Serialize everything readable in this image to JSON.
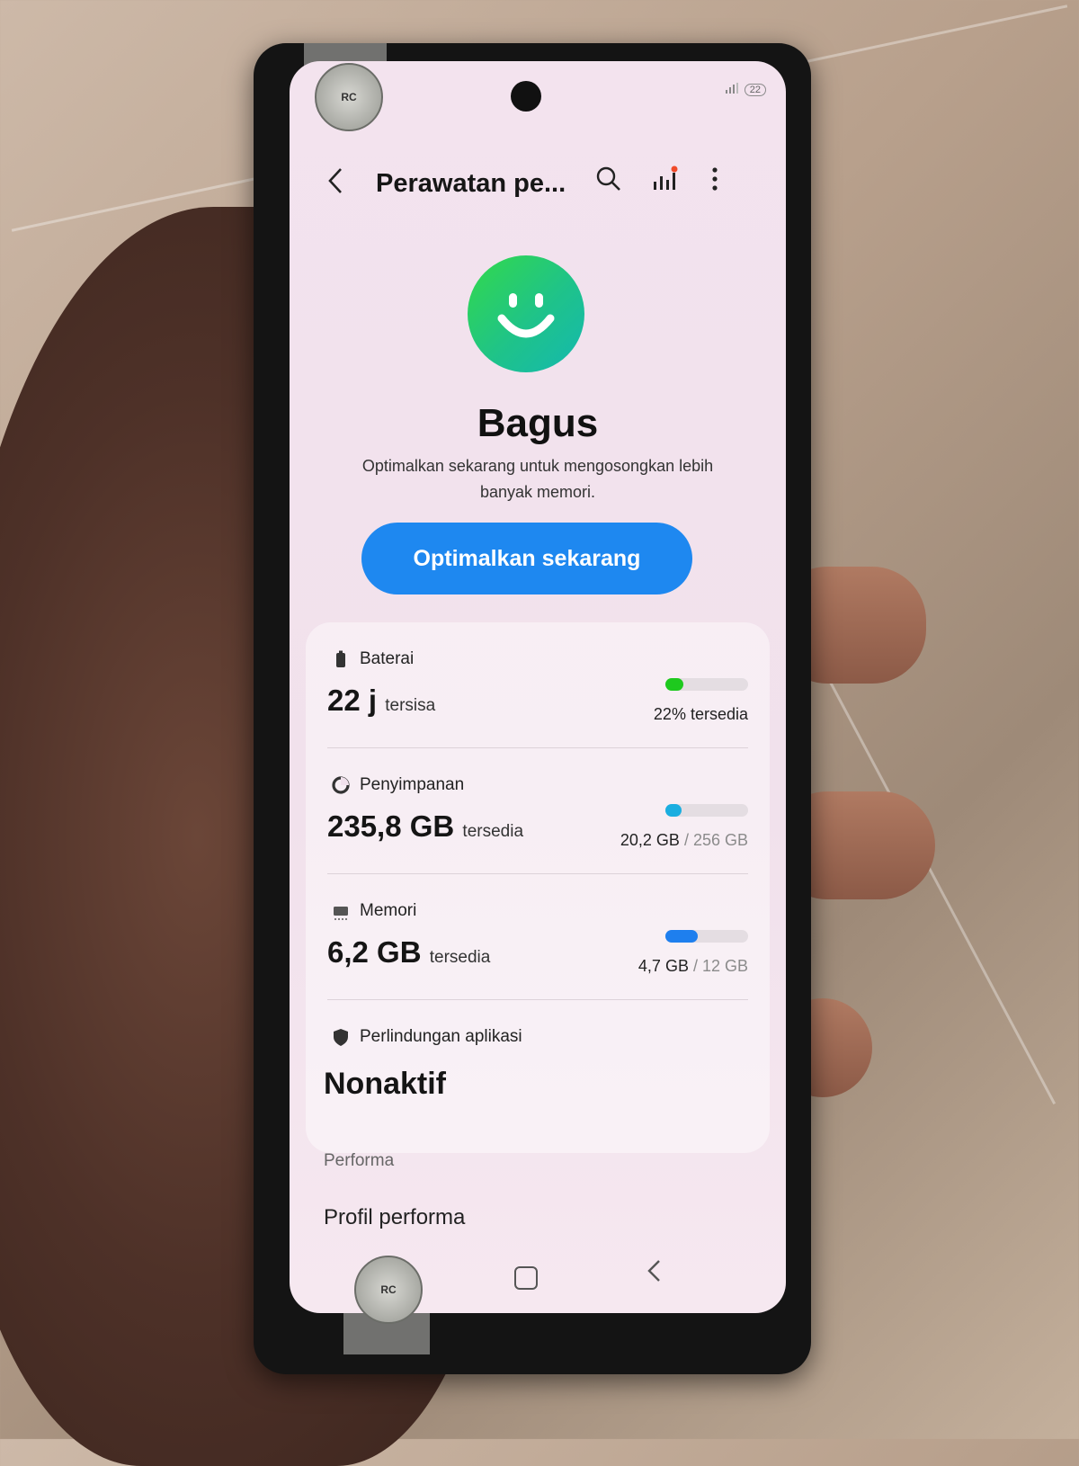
{
  "status_bar": {
    "battery_level": "22"
  },
  "header": {
    "title": "Perawatan pe...",
    "back_icon": "chevron-left-icon",
    "search_icon": "search-icon",
    "stats_icon": "signal-stats-icon",
    "more_icon": "more-vertical-icon"
  },
  "status": {
    "icon": "smiley-face-icon",
    "title": "Bagus",
    "description": "Optimalkan sekarang untuk mengosongkan lebih banyak memori."
  },
  "optimize_button": {
    "label": "Optimalkan sekarang"
  },
  "items": {
    "battery": {
      "label": "Baterai",
      "value": "22 j",
      "value_suffix": "tersisa",
      "detail": "22% tersedia",
      "level": 0.22,
      "color": "#1ec91e"
    },
    "storage": {
      "label": "Penyimpanan",
      "value": "235,8 GB",
      "value_suffix": "tersedia",
      "detail_used": "20,2 GB",
      "detail_total": "/ 256 GB",
      "level": 0.08,
      "color": "#1aaee0"
    },
    "memory": {
      "label": "Memori",
      "value": "6,2 GB",
      "value_suffix": "tersedia",
      "detail_used": "4,7 GB",
      "detail_total": "/ 12 GB",
      "level": 0.39,
      "color": "#1e7fee"
    },
    "app_protection": {
      "label": "Perlindungan aplikasi",
      "value": "Nonaktif"
    }
  },
  "performance": {
    "section_label": "Performa",
    "profile_label": "Profil performa"
  },
  "sticker_text": "RC"
}
